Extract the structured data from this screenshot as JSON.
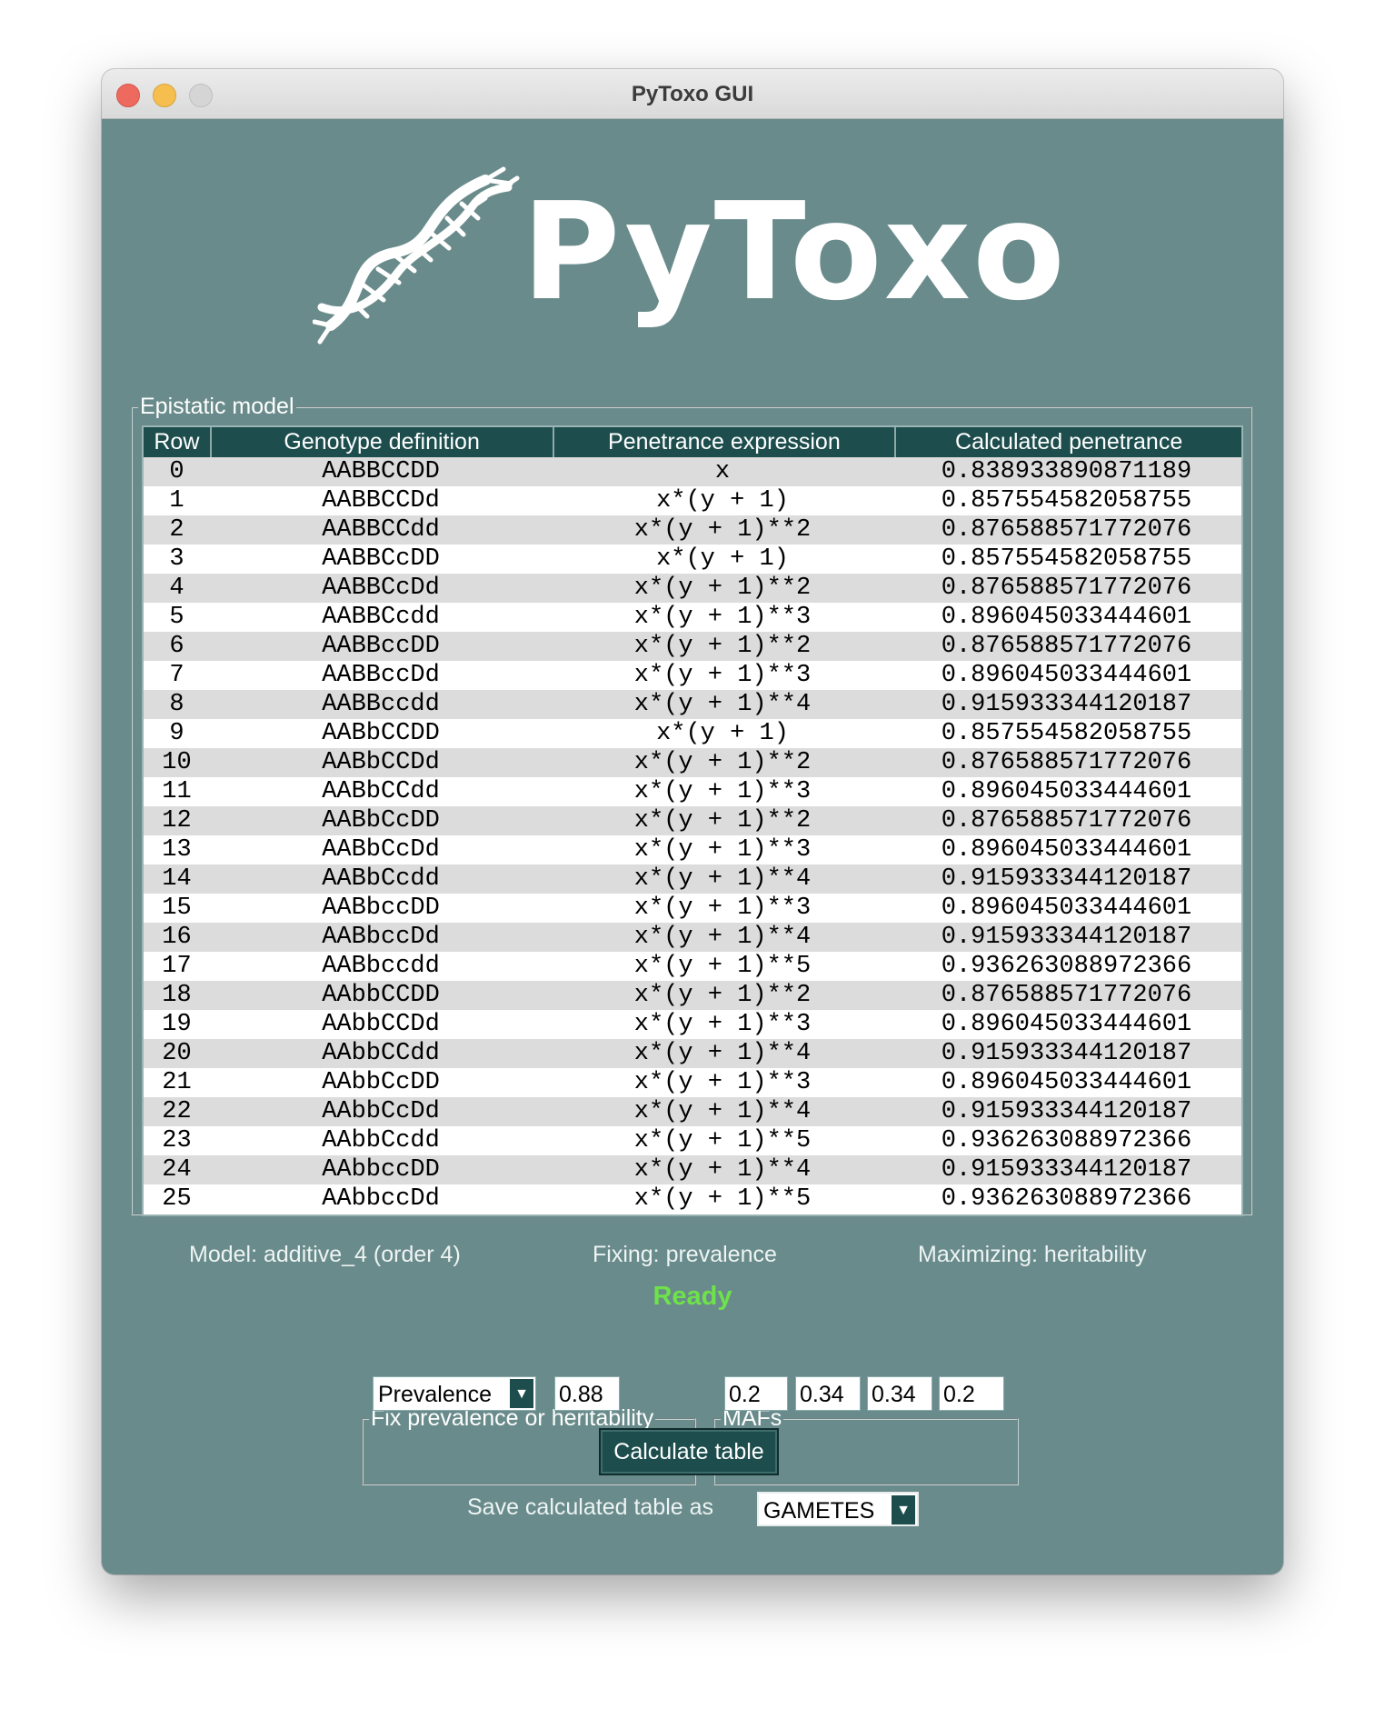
{
  "window": {
    "title": "PyToxo GUI"
  },
  "logo": {
    "text": "PyToxo"
  },
  "epistatic_model": {
    "legend": "Epistatic model",
    "columns": [
      "Row",
      "Genotype definition",
      "Penetrance expression",
      "Calculated penetrance"
    ],
    "rows": [
      [
        "0",
        "AABBCCDD",
        "x",
        "0.838933890871189"
      ],
      [
        "1",
        "AABBCCDd",
        "x*(y + 1)",
        "0.857554582058755"
      ],
      [
        "2",
        "AABBCCdd",
        "x*(y + 1)**2",
        "0.876588571772076"
      ],
      [
        "3",
        "AABBCcDD",
        "x*(y + 1)",
        "0.857554582058755"
      ],
      [
        "4",
        "AABBCcDd",
        "x*(y + 1)**2",
        "0.876588571772076"
      ],
      [
        "5",
        "AABBCcdd",
        "x*(y + 1)**3",
        "0.896045033444601"
      ],
      [
        "6",
        "AABBccDD",
        "x*(y + 1)**2",
        "0.876588571772076"
      ],
      [
        "7",
        "AABBccDd",
        "x*(y + 1)**3",
        "0.896045033444601"
      ],
      [
        "8",
        "AABBccdd",
        "x*(y + 1)**4",
        "0.915933344120187"
      ],
      [
        "9",
        "AABbCCDD",
        "x*(y + 1)",
        "0.857554582058755"
      ],
      [
        "10",
        "AABbCCDd",
        "x*(y + 1)**2",
        "0.876588571772076"
      ],
      [
        "11",
        "AABbCCdd",
        "x*(y + 1)**3",
        "0.896045033444601"
      ],
      [
        "12",
        "AABbCcDD",
        "x*(y + 1)**2",
        "0.876588571772076"
      ],
      [
        "13",
        "AABbCcDd",
        "x*(y + 1)**3",
        "0.896045033444601"
      ],
      [
        "14",
        "AABbCcdd",
        "x*(y + 1)**4",
        "0.915933344120187"
      ],
      [
        "15",
        "AABbccDD",
        "x*(y + 1)**3",
        "0.896045033444601"
      ],
      [
        "16",
        "AABbccDd",
        "x*(y + 1)**4",
        "0.915933344120187"
      ],
      [
        "17",
        "AABbccdd",
        "x*(y + 1)**5",
        "0.936263088972366"
      ],
      [
        "18",
        "AAbbCCDD",
        "x*(y + 1)**2",
        "0.876588571772076"
      ],
      [
        "19",
        "AAbbCCDd",
        "x*(y + 1)**3",
        "0.896045033444601"
      ],
      [
        "20",
        "AAbbCCdd",
        "x*(y + 1)**4",
        "0.915933344120187"
      ],
      [
        "21",
        "AAbbCcDD",
        "x*(y + 1)**3",
        "0.896045033444601"
      ],
      [
        "22",
        "AAbbCcDd",
        "x*(y + 1)**4",
        "0.915933344120187"
      ],
      [
        "23",
        "AAbbCcdd",
        "x*(y + 1)**5",
        "0.936263088972366"
      ],
      [
        "24",
        "AAbbccDD",
        "x*(y + 1)**4",
        "0.915933344120187"
      ],
      [
        "25",
        "AAbbccDd",
        "x*(y + 1)**5",
        "0.936263088972366"
      ]
    ]
  },
  "info": {
    "model": "Model: additive_4 (order 4)",
    "fixing": "Fixing: prevalence",
    "maximizing": "Maximizing: heritability"
  },
  "status": {
    "text": "Ready",
    "color": "#6ee24a"
  },
  "fix_group": {
    "legend": "Fix prevalence or heritability",
    "selected": "Prevalence",
    "value": "0.88"
  },
  "mafs_group": {
    "legend": "MAFs",
    "values": [
      "0.2",
      "0.34",
      "0.34",
      "0.2"
    ]
  },
  "calculate_button": {
    "label": "Calculate table"
  },
  "save": {
    "label": "Save calculated table as",
    "selected": "GAMETES"
  },
  "colors": {
    "background": "#6a8b8b",
    "header": "#1d4d4d",
    "accent_text": "#ffffff"
  },
  "icons": {
    "logo": "dna-helix-icon",
    "dropdown": "chevron-down-icon"
  }
}
